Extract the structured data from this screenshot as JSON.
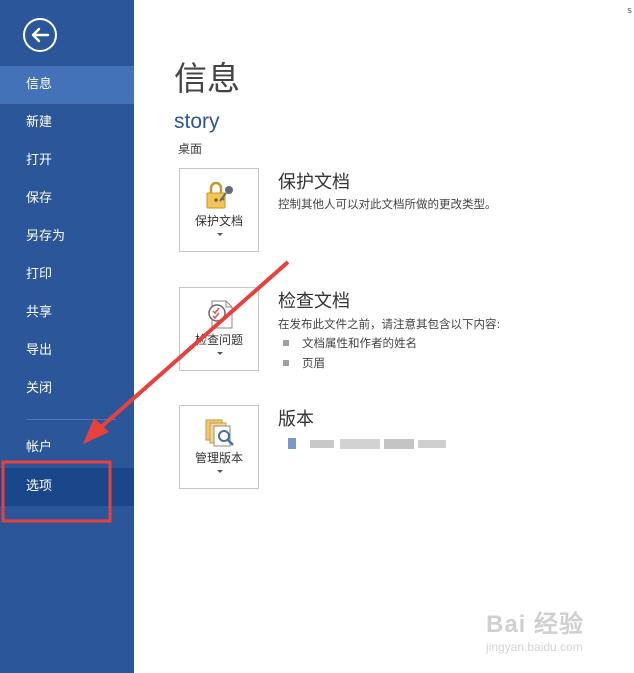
{
  "sidebar": {
    "items": [
      {
        "label": "信息"
      },
      {
        "label": "新建"
      },
      {
        "label": "打开"
      },
      {
        "label": "保存"
      },
      {
        "label": "另存为"
      },
      {
        "label": "打印"
      },
      {
        "label": "共享"
      },
      {
        "label": "导出"
      },
      {
        "label": "关闭"
      },
      {
        "label": "帐户"
      },
      {
        "label": "选项"
      }
    ]
  },
  "main": {
    "title": "信息",
    "document_name": "story",
    "document_location": "桌面",
    "protect": {
      "button_label": "保护文档",
      "title": "保护文档",
      "description": "控制其他人可以对此文档所做的更改类型。"
    },
    "inspect": {
      "button_label": "检查问题",
      "title": "检查文档",
      "description": "在发布此文件之前，请注意其包含以下内容:",
      "bullets": [
        "文档属性和作者的姓名",
        "页眉"
      ]
    },
    "versions": {
      "button_label": "管理版本",
      "title": "版本"
    }
  },
  "corner_text": "s",
  "watermark": {
    "text": "Bai  经验",
    "sub": "jingyan.baidu.com"
  },
  "colors": {
    "sidebar": "#2b579a",
    "sidebar_active": "#4472b8",
    "accent": "#2b579a",
    "annotation": "#e8403c"
  }
}
